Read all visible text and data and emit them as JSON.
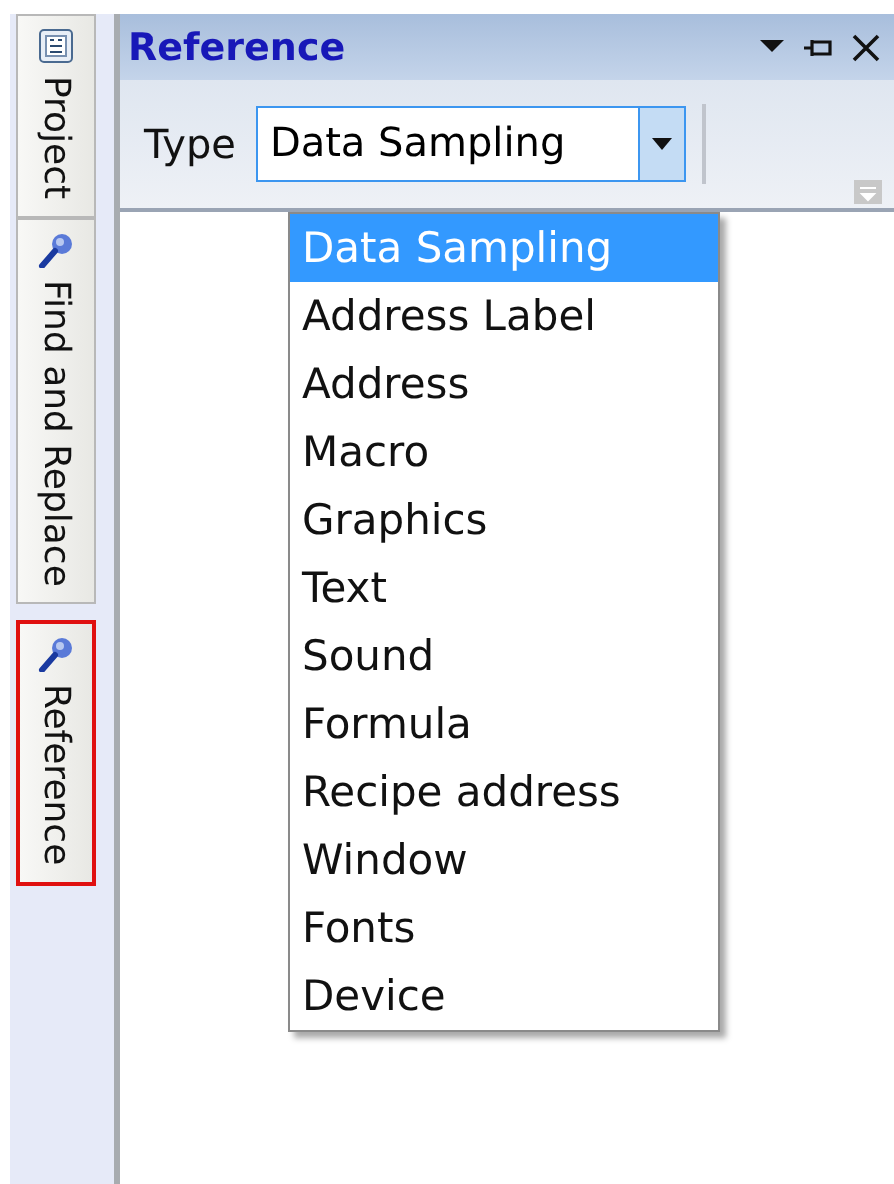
{
  "side_tabs": [
    {
      "label": "Project",
      "kind": "project",
      "marked": false
    },
    {
      "label": "Find and Replace",
      "kind": "tool",
      "marked": false
    },
    {
      "label": "Reference",
      "kind": "tool",
      "marked": true
    }
  ],
  "panel": {
    "title": "Reference"
  },
  "toolbar": {
    "label": "Type",
    "combo_value": "Data Sampling"
  },
  "dropdown": [
    {
      "label": "Data Sampling",
      "selected": true
    },
    {
      "label": "Address Label",
      "selected": false
    },
    {
      "label": "Address",
      "selected": false
    },
    {
      "label": "Macro",
      "selected": false
    },
    {
      "label": "Graphics",
      "selected": false
    },
    {
      "label": "Text",
      "selected": false
    },
    {
      "label": "Sound",
      "selected": false
    },
    {
      "label": "Formula",
      "selected": false
    },
    {
      "label": "Recipe address",
      "selected": false
    },
    {
      "label": "Window",
      "selected": false
    },
    {
      "label": "Fonts",
      "selected": false
    },
    {
      "label": "Device",
      "selected": false
    }
  ]
}
